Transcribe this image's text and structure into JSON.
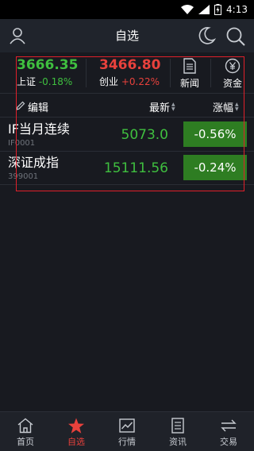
{
  "status_bar": {
    "time": "4:13"
  },
  "navbar": {
    "title": "自选"
  },
  "indices": [
    {
      "value": "3666.35",
      "label": "上证",
      "change": "-0.18%"
    },
    {
      "value": "3466.80",
      "label": "创业",
      "change": "+0.22%"
    }
  ],
  "quick_actions": [
    {
      "label": "新闻",
      "icon": "news-icon"
    },
    {
      "label": "资金",
      "icon": "yuan-icon"
    }
  ],
  "table_header": {
    "edit_label": "编辑",
    "latest_label": "最新",
    "change_label": "涨幅"
  },
  "rows": [
    {
      "name": "IF当月连续",
      "code": "IF0001",
      "price": "5073.0",
      "change": "-0.56%"
    },
    {
      "name": "深证成指",
      "code": "399001",
      "price": "15111.56",
      "change": "-0.24%"
    }
  ],
  "tabs": [
    {
      "label": "首页",
      "icon": "home-icon",
      "active": false
    },
    {
      "label": "自选",
      "icon": "star-icon",
      "active": true
    },
    {
      "label": "行情",
      "icon": "chart-icon",
      "active": false
    },
    {
      "label": "资讯",
      "icon": "document-icon",
      "active": false
    },
    {
      "label": "交易",
      "icon": "exchange-icon",
      "active": false
    }
  ],
  "colors": {
    "up": "#e8413c",
    "down": "#3fbf3f",
    "down_badge": "#2e7d22",
    "background": "#181a20",
    "highlight": "#e0202a"
  }
}
